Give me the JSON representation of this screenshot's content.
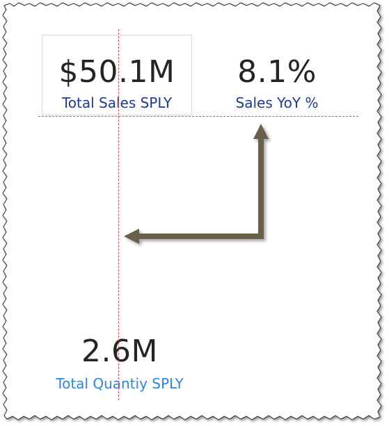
{
  "cards": {
    "total_sales_sply": {
      "value": "$50.1M",
      "label": "Total Sales SPLY",
      "label_color": "#1f3a93"
    },
    "sales_yoy": {
      "value": "8.1%",
      "label": "Sales YoY %",
      "label_color": "#1f3a93"
    },
    "total_quantity_sply": {
      "value": "2.6M",
      "label": "Total Quantiy SPLY",
      "label_color": "#2f86e0"
    }
  },
  "colors": {
    "value_text": "#252423",
    "guide_line": "#d9534f",
    "arrow": "#6b6149",
    "card_border": "#dadada"
  },
  "icons": {
    "arrow": "elbow-arrow-icon"
  }
}
